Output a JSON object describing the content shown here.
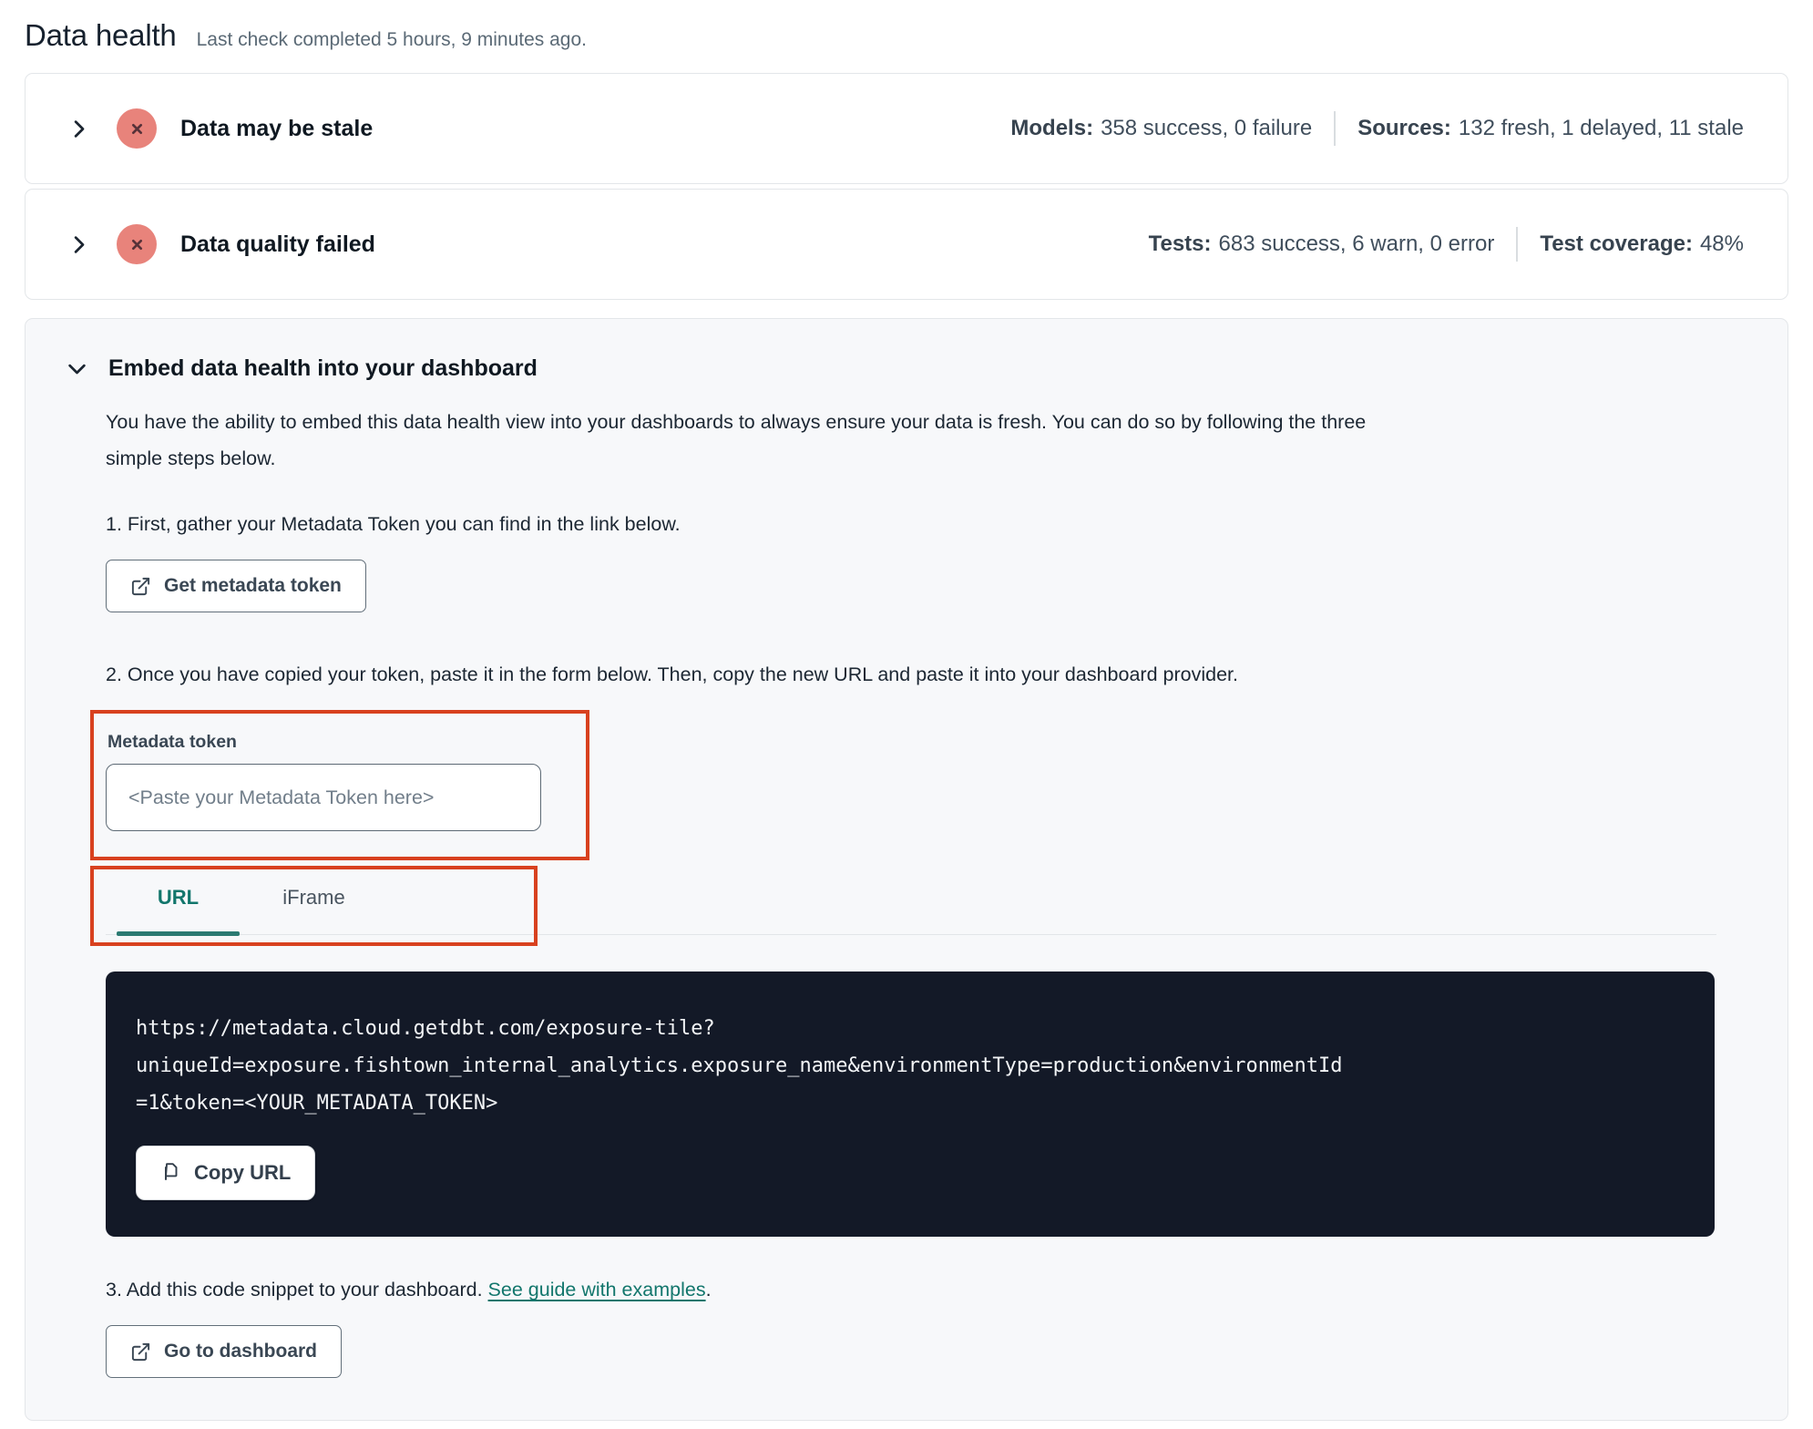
{
  "page": {
    "title": "Data health",
    "subtitle": "Last check completed 5 hours, 9 minutes ago."
  },
  "status_panels": [
    {
      "title": "Data may be stale",
      "status": "error",
      "metrics": [
        {
          "label": "Models:",
          "value": "358 success, 0 failure"
        },
        {
          "label": "Sources:",
          "value": "132 fresh, 1 delayed, 11 stale"
        }
      ]
    },
    {
      "title": "Data quality failed",
      "status": "error",
      "metrics": [
        {
          "label": "Tests:",
          "value": "683 success, 6 warn, 0 error"
        },
        {
          "label": "Test coverage:",
          "value": "48%"
        }
      ]
    }
  ],
  "embed_section": {
    "title": "Embed data health into your dashboard",
    "description_line1": "You have the ability to embed this data health view into your dashboards to always ensure your data is fresh. You can do so by following the three",
    "description_line2": "simple steps below.",
    "step1": {
      "text": "1. First, gather your Metadata Token you can find in the link below.",
      "button_label": "Get metadata token"
    },
    "step2": {
      "text": "2. Once you have copied your token, paste it in the form below. Then, copy the new URL and paste it into your dashboard provider.",
      "token_field": {
        "label": "Metadata token",
        "value": "",
        "placeholder": "<Paste your Metadata Token here>"
      },
      "tabs": [
        {
          "label": "URL",
          "active": true
        },
        {
          "label": "iFrame",
          "active": false
        }
      ],
      "code_url": "https://metadata.cloud.getdbt.com/exposure-tile?uniqueId=exposure.fishtown_internal_analytics.exposure_name&environmentType=production&environmentId=1&token=<YOUR_METADATA_TOKEN>",
      "code_url_lines": [
        "https://metadata.cloud.getdbt.com/exposure-tile?",
        "uniqueId=exposure.fishtown_internal_analytics.exposure_name&environmentType=production&environmentId",
        "=1&token=<YOUR_METADATA_TOKEN>"
      ],
      "copy_button_label": "Copy URL"
    },
    "step3": {
      "text_before_link": "3. Add this code snippet to your dashboard. ",
      "link_text": "See guide with examples",
      "text_after_link": ".",
      "button_label": "Go to dashboard"
    }
  },
  "colors": {
    "accent_teal": "#12766c",
    "error_icon_bg": "#e8837b",
    "error_icon_x": "#573239",
    "annotation_red": "#d8411f",
    "code_background": "#131927",
    "card_background": "#f7f8fa"
  }
}
